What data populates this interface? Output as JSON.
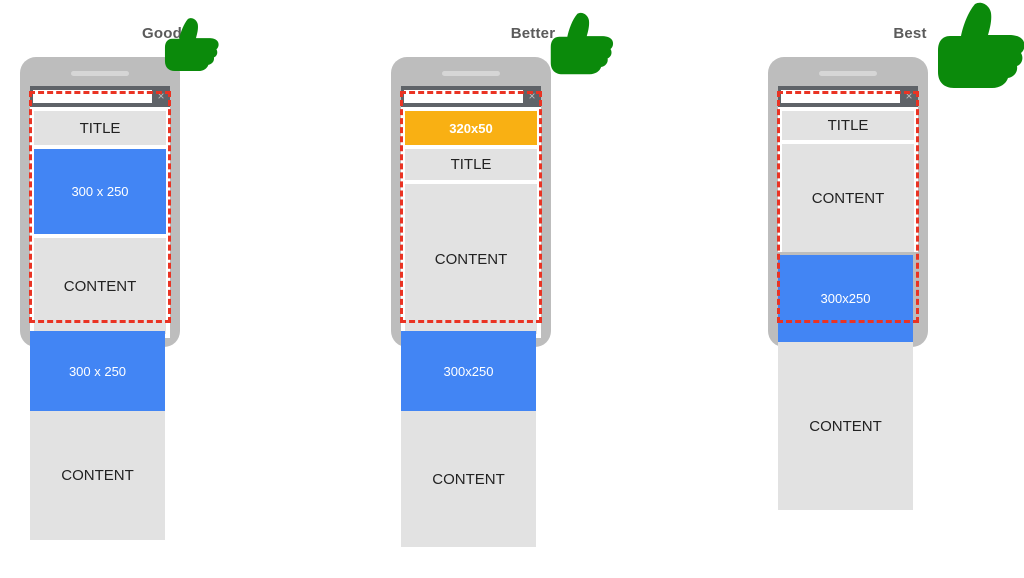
{
  "diagram": {
    "title": "Mobile ad placement: Good / Better / Best",
    "accent_blue": "#4285f4",
    "accent_yellow": "#f9b013",
    "viewport_outline_color": "#ea3323",
    "thumb_color": "#0b8a0b",
    "phone_body_color": "#bdbdbd",
    "browser_bar_color": "#5f6368",
    "content_block_color": "#e2e2e2"
  },
  "columns": [
    {
      "heading": "Good",
      "thumb_icon": "thumbs-up-icon",
      "thumb_size": "small",
      "browser": {
        "url_value": "",
        "url_placeholder": "",
        "close_label": "×"
      },
      "above_fold": [
        {
          "kind": "title",
          "label": "TITLE"
        },
        {
          "kind": "ad-blue",
          "label": "300 x 250"
        },
        {
          "kind": "content",
          "label": "CONTENT"
        }
      ],
      "below_fold": [
        {
          "kind": "ad-blue",
          "label": "300 x 250"
        },
        {
          "kind": "content",
          "label": "CONTENT"
        }
      ]
    },
    {
      "heading": "Better",
      "thumb_icon": "thumbs-up-icon",
      "thumb_size": "medium",
      "browser": {
        "url_value": "",
        "url_placeholder": "",
        "close_label": "×"
      },
      "above_fold": [
        {
          "kind": "ad-yellow",
          "label": "320x50"
        },
        {
          "kind": "title",
          "label": "TITLE"
        },
        {
          "kind": "content",
          "label": "CONTENT"
        }
      ],
      "below_fold": [
        {
          "kind": "ad-blue",
          "label": "300x250"
        },
        {
          "kind": "content",
          "label": "CONTENT"
        }
      ]
    },
    {
      "heading": "Best",
      "thumb_icon": "thumbs-up-icon",
      "thumb_size": "large",
      "browser": {
        "url_value": "",
        "url_placeholder": "",
        "close_label": "×"
      },
      "above_fold": [
        {
          "kind": "title",
          "label": "TITLE"
        },
        {
          "kind": "content",
          "label": "CONTENT"
        },
        {
          "kind": "ad-blue",
          "label": "300x250"
        }
      ],
      "below_fold": [
        {
          "kind": "content",
          "label": "CONTENT"
        }
      ]
    }
  ]
}
